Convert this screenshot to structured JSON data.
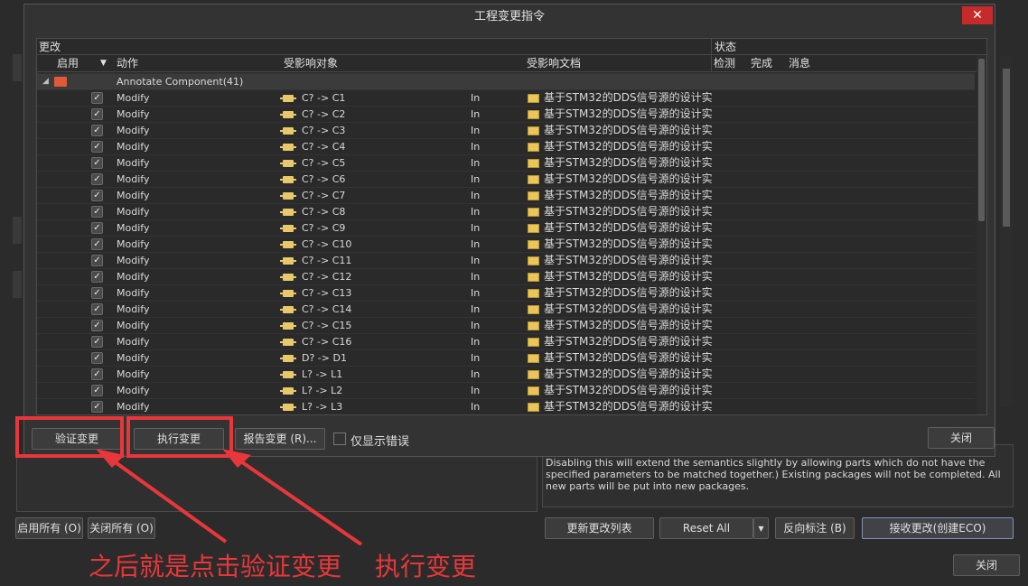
{
  "dialog": {
    "title": "工程变更指令",
    "close_glyph": "✕"
  },
  "grid": {
    "group_headers": {
      "changes": "更改",
      "status": "状态"
    },
    "columns": {
      "enable": "启用",
      "action": "动作",
      "affected_object": "受影响对象",
      "affected_doc": "受影响文档",
      "check": "检测",
      "done": "完成",
      "message": "消息"
    },
    "group_row": {
      "label": "Annotate Component(41)"
    },
    "rows": [
      {
        "action": "Modify",
        "object": "C? -> C1",
        "in": "In",
        "doc": "基于STM32的DDS信号源的设计实"
      },
      {
        "action": "Modify",
        "object": "C? -> C2",
        "in": "In",
        "doc": "基于STM32的DDS信号源的设计实"
      },
      {
        "action": "Modify",
        "object": "C? -> C3",
        "in": "In",
        "doc": "基于STM32的DDS信号源的设计实"
      },
      {
        "action": "Modify",
        "object": "C? -> C4",
        "in": "In",
        "doc": "基于STM32的DDS信号源的设计实"
      },
      {
        "action": "Modify",
        "object": "C? -> C5",
        "in": "In",
        "doc": "基于STM32的DDS信号源的设计实"
      },
      {
        "action": "Modify",
        "object": "C? -> C6",
        "in": "In",
        "doc": "基于STM32的DDS信号源的设计实"
      },
      {
        "action": "Modify",
        "object": "C? -> C7",
        "in": "In",
        "doc": "基于STM32的DDS信号源的设计实"
      },
      {
        "action": "Modify",
        "object": "C? -> C8",
        "in": "In",
        "doc": "基于STM32的DDS信号源的设计实"
      },
      {
        "action": "Modify",
        "object": "C? -> C9",
        "in": "In",
        "doc": "基于STM32的DDS信号源的设计实"
      },
      {
        "action": "Modify",
        "object": "C? -> C10",
        "in": "In",
        "doc": "基于STM32的DDS信号源的设计实"
      },
      {
        "action": "Modify",
        "object": "C? -> C11",
        "in": "In",
        "doc": "基于STM32的DDS信号源的设计实"
      },
      {
        "action": "Modify",
        "object": "C? -> C12",
        "in": "In",
        "doc": "基于STM32的DDS信号源的设计实"
      },
      {
        "action": "Modify",
        "object": "C? -> C13",
        "in": "In",
        "doc": "基于STM32的DDS信号源的设计实"
      },
      {
        "action": "Modify",
        "object": "C? -> C14",
        "in": "In",
        "doc": "基于STM32的DDS信号源的设计实"
      },
      {
        "action": "Modify",
        "object": "C? -> C15",
        "in": "In",
        "doc": "基于STM32的DDS信号源的设计实"
      },
      {
        "action": "Modify",
        "object": "C? -> C16",
        "in": "In",
        "doc": "基于STM32的DDS信号源的设计实"
      },
      {
        "action": "Modify",
        "object": "D? -> D1",
        "in": "In",
        "doc": "基于STM32的DDS信号源的设计实"
      },
      {
        "action": "Modify",
        "object": "L? -> L1",
        "in": "In",
        "doc": "基于STM32的DDS信号源的设计实"
      },
      {
        "action": "Modify",
        "object": "L? -> L2",
        "in": "In",
        "doc": "基于STM32的DDS信号源的设计实"
      },
      {
        "action": "Modify",
        "object": "L? -> L3",
        "in": "In",
        "doc": "基于STM32的DDS信号源的设计实"
      }
    ]
  },
  "dialog_buttons": {
    "validate": "验证变更",
    "execute": "执行变更",
    "report": "报告变更 (R)...",
    "only_errors": "仅显示错误",
    "close": "关闭"
  },
  "background": {
    "description": "have the same parameters and parameter values, with respect to the matching criteria. Disabling this will extend the semantics slightly by allowing parts which do not have the specified parameters to be matched together.) Existing packages will not be completed. All new parts will be put into new packages.",
    "enable_all": "启用所有 (O)",
    "disable_all": "关闭所有 (O)",
    "update_list": "更新更改列表",
    "reset_all": "Reset All",
    "back_annotate": "反向标注 (B)",
    "accept_changes": "接收更改(创建ECO)",
    "close": "关闭"
  },
  "annotation": {
    "text1": "之后就是点击验证变更",
    "text2": "执行变更",
    "color": "#e8373a"
  }
}
